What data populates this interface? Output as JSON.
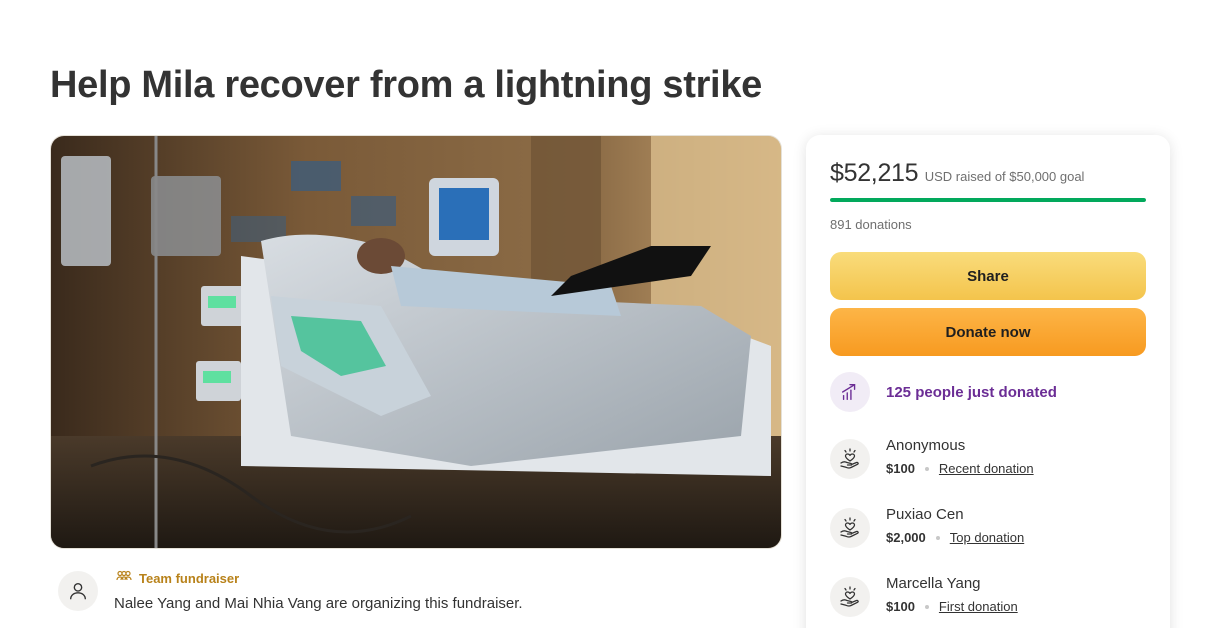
{
  "page": {
    "title": "Help Mila recover from a lightning strike"
  },
  "organizer": {
    "badge_label": "Team fundraiser",
    "text": "Nalee Yang and Mai Nhia Vang are organizing this fundraiser."
  },
  "donation_card": {
    "amount_raised": "$52,215",
    "goal_text": "USD raised of $50,000 goal",
    "progress_fraction": 1.0,
    "donation_count": "891 donations",
    "share_label": "Share",
    "donate_label": "Donate now",
    "recent_activity": "125 people just donated",
    "donors": [
      {
        "name": "Anonymous",
        "amount": "$100",
        "tag": "Recent donation"
      },
      {
        "name": "Puxiao Cen",
        "amount": "$2,000",
        "tag": "Top donation"
      },
      {
        "name": "Marcella Yang",
        "amount": "$100",
        "tag": "First donation"
      }
    ]
  },
  "colors": {
    "progress_green": "#02a95c",
    "share_yellow": "#f4c44c",
    "donate_orange": "#f79a20",
    "trend_purple": "#6b2d95",
    "badge_gold": "#b8821a"
  },
  "icons": {
    "organizer_avatar": "user-icon",
    "team_badge": "team-icon",
    "trend": "trending-up-icon",
    "donor": "heart-hand-icon"
  }
}
